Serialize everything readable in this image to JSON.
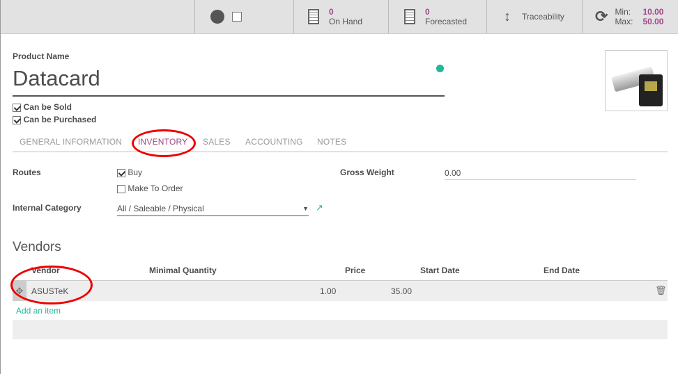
{
  "statusbar": {
    "on_hand": {
      "value": "0",
      "label": "On Hand"
    },
    "forecasted": {
      "value": "0",
      "label": "Forecasted"
    },
    "traceability": "Traceability",
    "reorder": {
      "min_label": "Min:",
      "min": "10.00",
      "max_label": "Max:",
      "max": "50.00"
    }
  },
  "product": {
    "name_label": "Product Name",
    "name": "Datacard",
    "can_be_sold": "Can be Sold",
    "can_be_purchased": "Can be Purchased"
  },
  "tabs": [
    "GENERAL INFORMATION",
    "INVENTORY",
    "SALES",
    "ACCOUNTING",
    "NOTES"
  ],
  "active_tab": "INVENTORY",
  "inventory": {
    "routes_label": "Routes",
    "route_buy": "Buy",
    "route_mto": "Make To Order",
    "category_label": "Internal Category",
    "category": "All / Saleable / Physical",
    "gross_weight_label": "Gross Weight",
    "gross_weight": "0.00"
  },
  "vendors": {
    "title": "Vendors",
    "columns": [
      "Vendor",
      "Minimal Quantity",
      "Price",
      "Start Date",
      "End Date"
    ],
    "rows": [
      {
        "vendor": "ASUSTeK",
        "min_qty": "1.00",
        "price": "35.00",
        "start": "",
        "end": ""
      }
    ],
    "add_item": "Add an item"
  },
  "colors": {
    "accent": "#a24689",
    "link": "#21b799",
    "annotation": "#e00000"
  }
}
